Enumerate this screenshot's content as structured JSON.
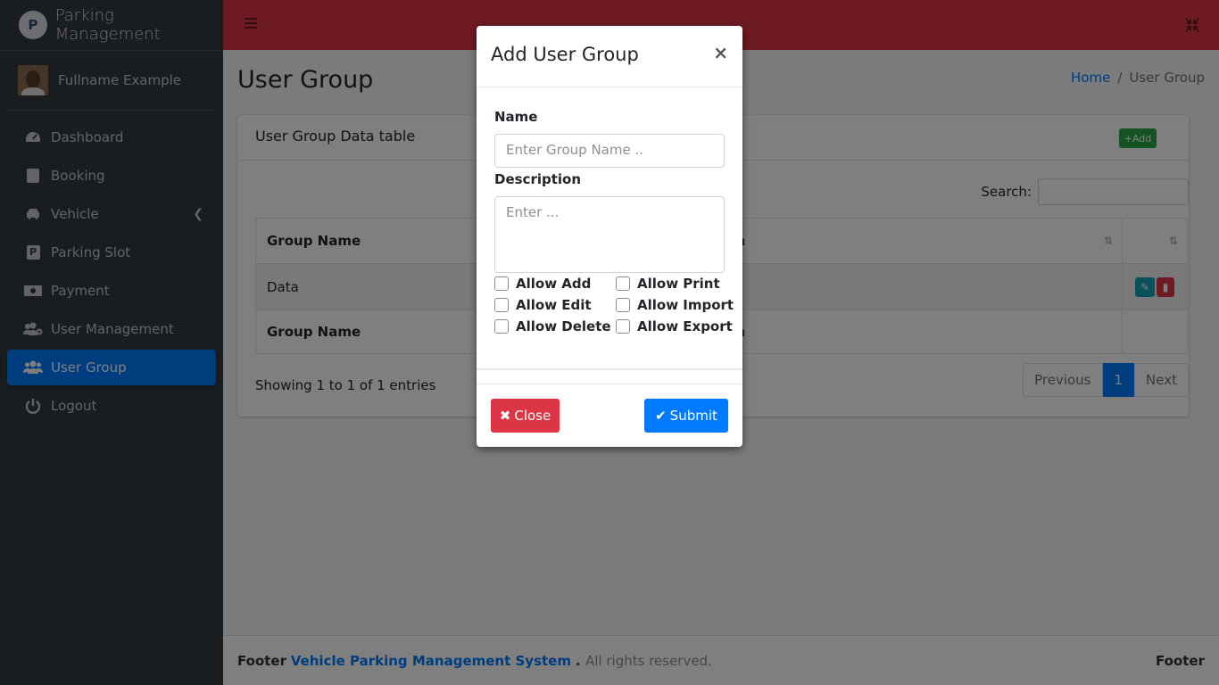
{
  "brand": {
    "logo_text": "P",
    "name": "Parking Management"
  },
  "user": {
    "name": "Fullname Example"
  },
  "sidebar": {
    "items": [
      {
        "label": "Dashboard",
        "icon": "tachometer-icon"
      },
      {
        "label": "Booking",
        "icon": "book-icon"
      },
      {
        "label": "Vehicle",
        "icon": "car-icon"
      },
      {
        "label": "Parking Slot",
        "icon": "parking-icon"
      },
      {
        "label": "Payment",
        "icon": "money-icon"
      },
      {
        "label": "User Management",
        "icon": "users-cog-icon"
      },
      {
        "label": "User Group",
        "icon": "users-icon",
        "active": true
      },
      {
        "label": "Logout",
        "icon": "power-icon"
      }
    ]
  },
  "page": {
    "title": "User Group"
  },
  "breadcrumb": {
    "home": "Home",
    "current": "User Group"
  },
  "card": {
    "title": "User Group Data table",
    "add_label": "+Add",
    "search_label": "Search:"
  },
  "table": {
    "headers": [
      "Group Name",
      "Description",
      ""
    ],
    "visible_header_2": "ription",
    "rows": [
      [
        "Data",
        ""
      ]
    ],
    "footers": [
      "Group Name",
      "ription"
    ],
    "info": "Showing 1 to 1 of 1 entries"
  },
  "pagination": {
    "previous": "Previous",
    "current": "1",
    "next": "Next"
  },
  "footer": {
    "prefix": "Footer",
    "link": "Vehicle Parking Management System",
    "suffix": ". All rights reserved.",
    "right": "Footer"
  },
  "modal": {
    "title": "Add User Group",
    "close_glyph": "×",
    "name_label": "Name",
    "name_placeholder": "Enter Group Name ..",
    "desc_label": "Description",
    "desc_placeholder": "Enter ...",
    "checkboxes": [
      "Allow Add",
      "Allow Print",
      "Allow Edit",
      "Allow Import",
      "Allow Delete",
      "Allow Export"
    ],
    "close_button": "Close",
    "submit_button": "Submit"
  },
  "colors": {
    "header": "#dc3545",
    "sidebar": "#343a40",
    "primary": "#007bff",
    "success": "#28a745"
  }
}
